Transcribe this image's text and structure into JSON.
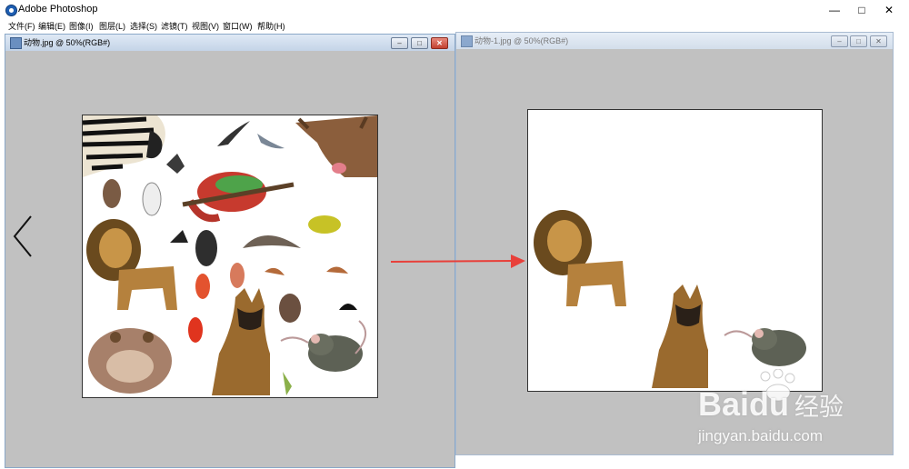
{
  "app": {
    "title": "Adobe Photoshop",
    "minimize": "—",
    "maximize": "□",
    "close": "✕"
  },
  "menu": [
    "文件(F)",
    "编辑(E)",
    "图像(I)",
    "图层(L)",
    "选择(S)",
    "滤镜(T)",
    "视图(V)",
    "窗口(W)",
    "帮助(H)"
  ],
  "doc_left": {
    "title": "动物.jpg @ 50%(RGB#)",
    "min": "–",
    "max": "□",
    "close": "✕"
  },
  "doc_right": {
    "title": "动物-1.jpg @ 50%(RGB#)",
    "min": "–",
    "max": "□",
    "close": "✕"
  },
  "watermark": {
    "logo_text": "Bai",
    "logo_suffix": "du",
    "logo_cn": "经验",
    "url": "jingyan.baidu.com"
  },
  "colors": {
    "workspace": "#c1c1c1",
    "arrow": "#e8403a",
    "canvas": "#ffffff",
    "frame_border": "#8aa8c8"
  },
  "icons": [
    "photoshop-app-icon",
    "document-icon",
    "back-chevron-icon",
    "red-arrow-icon",
    "baidu-paw-icon"
  ]
}
